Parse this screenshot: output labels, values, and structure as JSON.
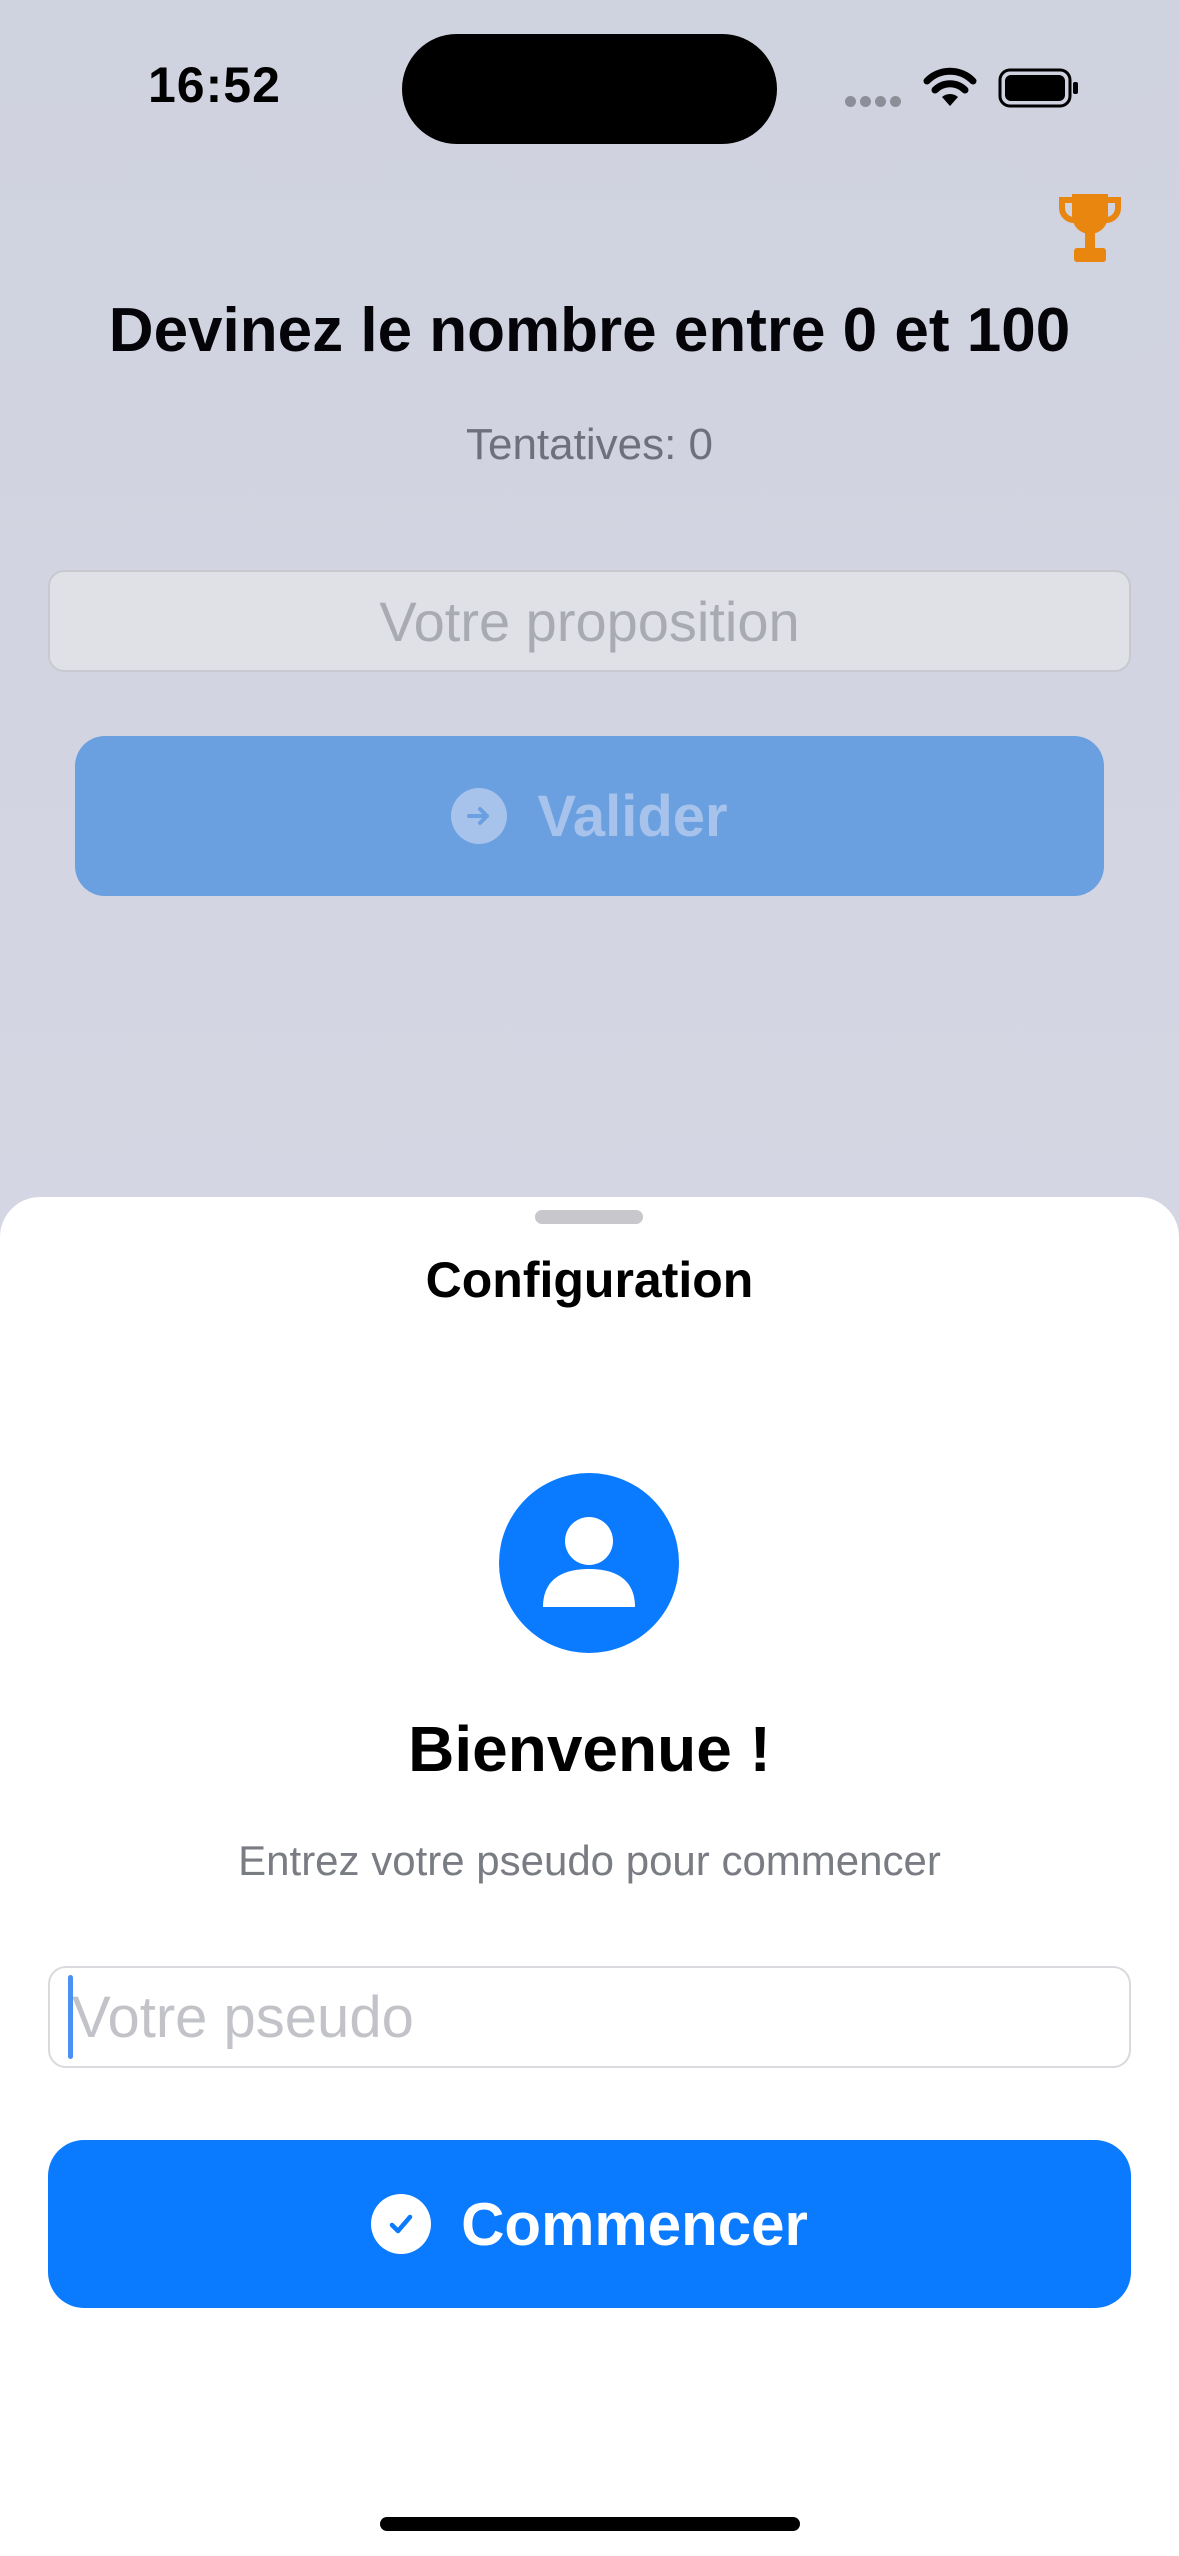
{
  "status_bar": {
    "time": "16:52",
    "icons": [
      "cellular-signal-icon",
      "wifi-icon",
      "battery-icon"
    ]
  },
  "game": {
    "leaderboard_icon": "trophy-icon",
    "trophy_color": "#E8860F",
    "title": "Devinez le nombre entre 0 et 100",
    "attempts": "Tentatives: 0",
    "guess_placeholder": "Votre proposition",
    "guess_value": "",
    "validate_label": "Valider",
    "validate_icon": "arrow-right-circle-icon"
  },
  "sheet": {
    "title": "Configuration",
    "avatar_icon": "person-circle-icon",
    "welcome": "Bienvenue !",
    "subtitle": "Entrez votre pseudo pour commencer",
    "nickname_placeholder": "Votre pseudo",
    "nickname_value": "",
    "start_label": "Commencer",
    "start_icon": "checkmark-circle-icon",
    "accent_color": "#0A7AFF"
  }
}
